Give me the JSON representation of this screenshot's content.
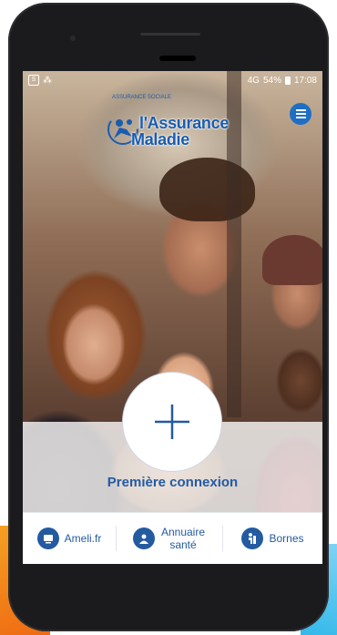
{
  "status_bar": {
    "carrier_icon": "S",
    "signal_text": "4G",
    "battery": "54%",
    "time": "17:08"
  },
  "logo": {
    "arc_text": "ASSURANCE SOCIALE",
    "line1": "l'Assurance",
    "line2": "Maladie"
  },
  "icons": {
    "menu": "hamburger-icon",
    "plus": "plus-icon",
    "ameli": "computer-icon",
    "annuaire": "doctor-icon",
    "bornes": "kiosk-icon"
  },
  "main": {
    "first_login_label": "Première connexion"
  },
  "nav": {
    "items": [
      {
        "label": "Ameli.fr"
      },
      {
        "label_line1": "Annuaire",
        "label_line2": "santé"
      },
      {
        "label": "Bornes"
      }
    ]
  },
  "colors": {
    "brand_blue": "#245aa0",
    "accent_orange": "#ee6a12",
    "accent_light_blue": "#33b8ea"
  }
}
